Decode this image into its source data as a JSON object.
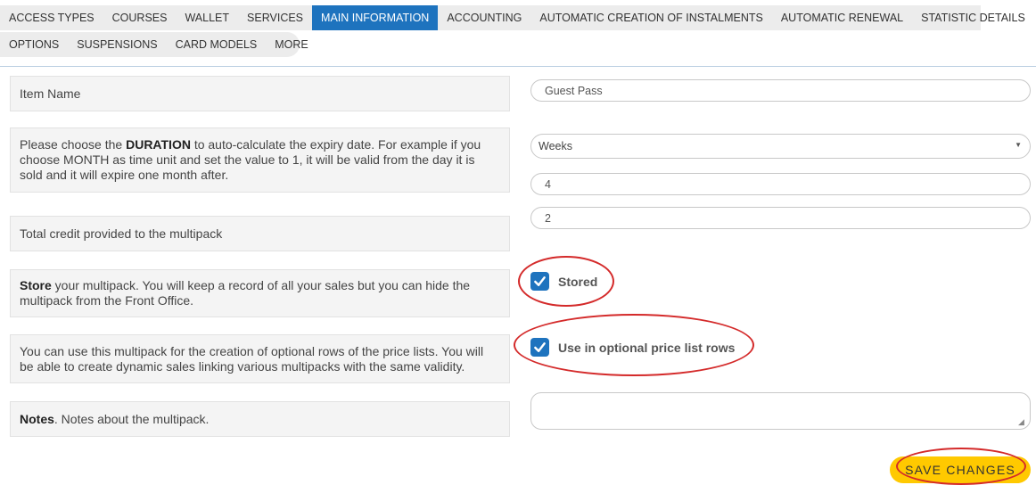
{
  "tabs_row1": [
    {
      "label": "ACCESS TYPES"
    },
    {
      "label": "COURSES"
    },
    {
      "label": "WALLET"
    },
    {
      "label": "SERVICES"
    },
    {
      "label": "MAIN INFORMATION",
      "active": true
    },
    {
      "label": "ACCOUNTING"
    },
    {
      "label": "AUTOMATIC CREATION OF INSTALMENTS"
    },
    {
      "label": "AUTOMATIC RENEWAL"
    },
    {
      "label": "STATISTIC DETAILS"
    }
  ],
  "tabs_row2": [
    {
      "label": "OPTIONS"
    },
    {
      "label": "SUSPENSIONS"
    },
    {
      "label": "CARD MODELS"
    },
    {
      "label": "MORE"
    }
  ],
  "form": {
    "item_name": {
      "label": "Item Name",
      "value": "Guest Pass"
    },
    "duration": {
      "text_before": "Please choose the ",
      "bold": "DURATION",
      "text_after": " to auto-calculate the expiry date. For example if you choose MONTH as time unit and set the value to 1, it will be valid from the day it is sold and it will expire one month after.",
      "unit_selected": "Weeks",
      "value": "4"
    },
    "credit": {
      "label": "Total credit provided to the multipack",
      "value": "2"
    },
    "store": {
      "bold": "Store",
      "text_after": " your multipack. You will keep a record of all your sales but you can hide the multipack from the Front Office.",
      "checkbox_label": "Stored",
      "checked": true
    },
    "optional_rows": {
      "text": "You can use this multipack for the creation of optional rows of the price lists. You will be able to create dynamic sales linking various multipacks with the same validity.",
      "checkbox_label": "Use in optional price list rows",
      "checked": true
    },
    "notes": {
      "bold": "Notes",
      "text_after": ". Notes about the multipack.",
      "value": ""
    }
  },
  "save_button": {
    "label": "SAVE CHANGES"
  },
  "colors": {
    "accent": "#1e73be",
    "save": "#ffc900",
    "annotation": "#d42a2a"
  }
}
